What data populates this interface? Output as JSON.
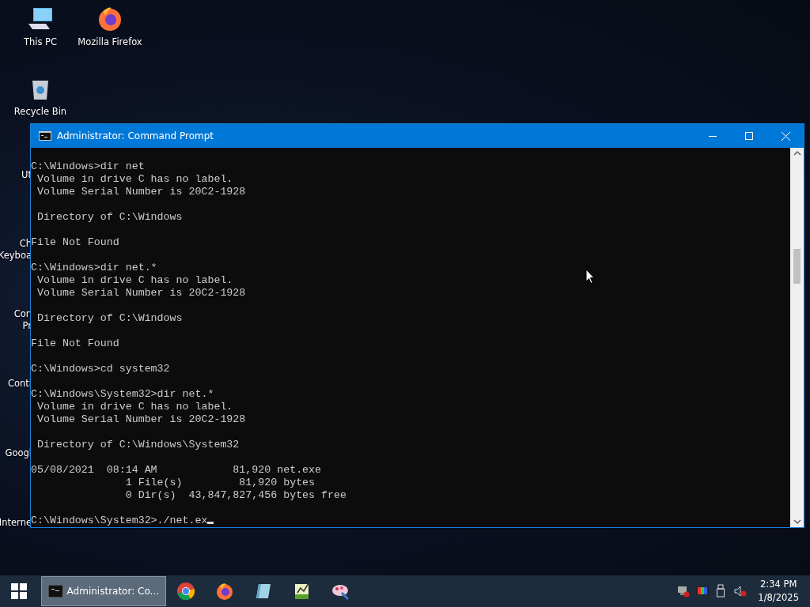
{
  "desktop_icons": [
    {
      "kind": "computer",
      "label_lines": [
        "This PC"
      ]
    },
    {
      "kind": "firefox",
      "label_lines": [
        "Mozilla Firefox"
      ]
    },
    {
      "kind": "recycle-bin",
      "label_lines": [
        "Recycle Bin"
      ]
    },
    {
      "kind": "hidden",
      "label_lines": [
        "Ut"
      ]
    },
    {
      "kind": "hidden",
      "label_lines": [
        "Ch",
        "Keyboa"
      ]
    },
    {
      "kind": "hidden",
      "label_lines": [
        "Con",
        "Pr"
      ]
    },
    {
      "kind": "hidden",
      "label_lines": [
        "Conti"
      ]
    },
    {
      "kind": "hidden",
      "label_lines": [
        "Googl"
      ]
    },
    {
      "kind": "hidden",
      "label_lines": [
        "Interne"
      ]
    }
  ],
  "window": {
    "title": "Administrator: Command Prompt",
    "console_blocks": [
      [
        "C:\\Windows>dir net",
        " Volume in drive C has no label.",
        " Volume Serial Number is 20C2-1928"
      ],
      [
        " Directory of C:\\Windows"
      ],
      [
        "File Not Found"
      ],
      [
        "C:\\Windows>dir net.*",
        " Volume in drive C has no label.",
        " Volume Serial Number is 20C2-1928"
      ],
      [
        " Directory of C:\\Windows"
      ],
      [
        "File Not Found"
      ],
      [
        "C:\\Windows>cd system32"
      ],
      [
        "C:\\Windows\\System32>dir net.*",
        " Volume in drive C has no label.",
        " Volume Serial Number is 20C2-1928"
      ],
      [
        " Directory of C:\\Windows\\System32"
      ],
      [
        "05/08/2021  08:14 AM            81,920 net.exe",
        "               1 File(s)         81,920 bytes",
        "               0 Dir(s)  43,847,827,456 bytes free"
      ],
      [
        "C:\\Windows\\System32>./net.ex"
      ]
    ]
  },
  "taskbar": {
    "active_task": {
      "label": "Administrator: Co..."
    },
    "pinned": [
      {
        "kind": "chrome"
      },
      {
        "kind": "firefox"
      },
      {
        "kind": "notebook"
      },
      {
        "kind": "chart"
      },
      {
        "kind": "paint"
      }
    ],
    "tray": [
      {
        "kind": "network"
      },
      {
        "kind": "color"
      },
      {
        "kind": "usb"
      },
      {
        "kind": "volume"
      }
    ],
    "time": "2:34 PM",
    "date": "1/8/2025"
  }
}
